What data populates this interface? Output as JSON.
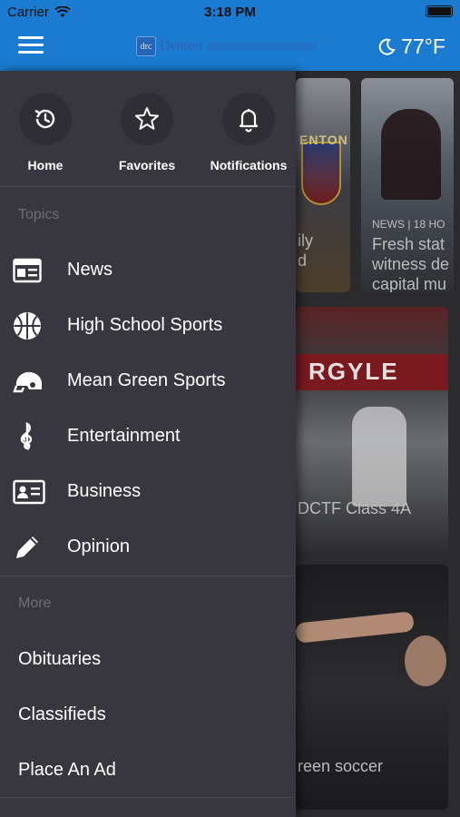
{
  "status_bar": {
    "carrier": "Carrier",
    "time": "3:18 PM"
  },
  "app_bar": {
    "logo_badge": "drc",
    "logo_name": "Denton",
    "temperature": "77°F"
  },
  "drawer": {
    "quick_links": [
      {
        "label": "Home",
        "icon": "home-refresh-icon"
      },
      {
        "label": "Favorites",
        "icon": "star-icon"
      },
      {
        "label": "Notifications",
        "icon": "bell-icon"
      }
    ],
    "topics_title": "Topics",
    "topics": [
      {
        "label": "News",
        "icon": "newspaper-icon"
      },
      {
        "label": "High School Sports",
        "icon": "basketball-icon"
      },
      {
        "label": "Mean Green Sports",
        "icon": "football-helmet-icon"
      },
      {
        "label": "Entertainment",
        "icon": "treble-clef-icon"
      },
      {
        "label": "Business",
        "icon": "business-card-icon"
      },
      {
        "label": "Opinion",
        "icon": "pencil-icon"
      }
    ],
    "more_title": "More",
    "more": [
      {
        "label": "Obituaries"
      },
      {
        "label": "Classifieds"
      },
      {
        "label": "Place An Ad"
      }
    ]
  },
  "feed": {
    "card_a": {
      "town": "ENTON",
      "caption": "ily\nd"
    },
    "card_b": {
      "tag": "NEWS | 18 HO",
      "caption": "Fresh stat\nwitness de\ncapital mu"
    },
    "card_c": {
      "banner": "RGYLE",
      "caption": "DCTF Class 4A"
    },
    "card_d": {
      "caption": "reen soccer"
    }
  },
  "colors": {
    "app_bar": "#1a7bd0",
    "drawer_bg": "#38373f",
    "section_title": "#6e6d75"
  }
}
